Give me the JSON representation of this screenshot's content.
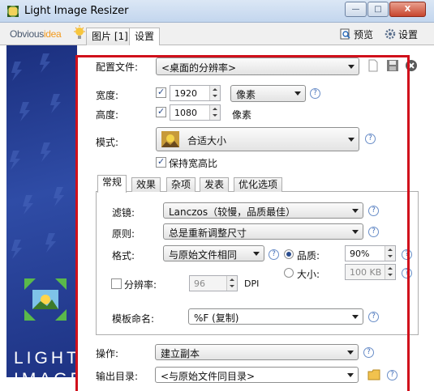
{
  "window": {
    "title": "Light Image Resizer",
    "minimize": "—",
    "maximize": "□",
    "close": "X"
  },
  "header": {
    "logo_part1": "Obvious",
    "logo_part2": "idea",
    "tabs": [
      {
        "label": "图片 [1]"
      },
      {
        "label": "设置"
      }
    ],
    "preview_label": "预览",
    "settings_label": "设置"
  },
  "sidebar": {
    "brand_line1": "LIGHT",
    "brand_line2": "IMAGE"
  },
  "settings": {
    "profile_label": "配置文件:",
    "profile_value": "<桌面的分辨率>",
    "width_label": "宽度:",
    "width_value": "1920",
    "width_checked": true,
    "unit_value": "像素",
    "height_label": "高度:",
    "height_value": "1080",
    "height_checked": true,
    "height_unit": "像素",
    "mode_label": "模式:",
    "mode_value": "合适大小",
    "keep_ratio_label": "保持宽高比",
    "keep_ratio_checked": true,
    "subtabs": [
      {
        "label": "常规"
      },
      {
        "label": "效果"
      },
      {
        "label": "杂项"
      },
      {
        "label": "发表"
      },
      {
        "label": "优化选项"
      }
    ],
    "filter_label": "滤镜:",
    "filter_value": "Lanczos（较慢，品质最佳）",
    "rule_label": "原则:",
    "rule_value": "总是重新调整尺寸",
    "format_label": "格式:",
    "format_value": "与原始文件相同",
    "quality_label": "品质:",
    "quality_value": "90%",
    "quality_selected": true,
    "size_label": "大小:",
    "size_value": "100 KB",
    "resolution_label": "分辨率:",
    "resolution_value": "96",
    "resolution_unit": "DPI",
    "resolution_checked": false,
    "template_label": "模板命名:",
    "template_value": "%F (复制)",
    "action_label": "操作:",
    "action_value": "建立副本",
    "output_label": "输出目录:",
    "output_value": "<与原始文件同目录>"
  },
  "help_glyph": "?",
  "colors": {
    "highlight_border": "#d0101b",
    "sidebar": "#2f4ca6",
    "logo_accent": "#f39a1d"
  }
}
